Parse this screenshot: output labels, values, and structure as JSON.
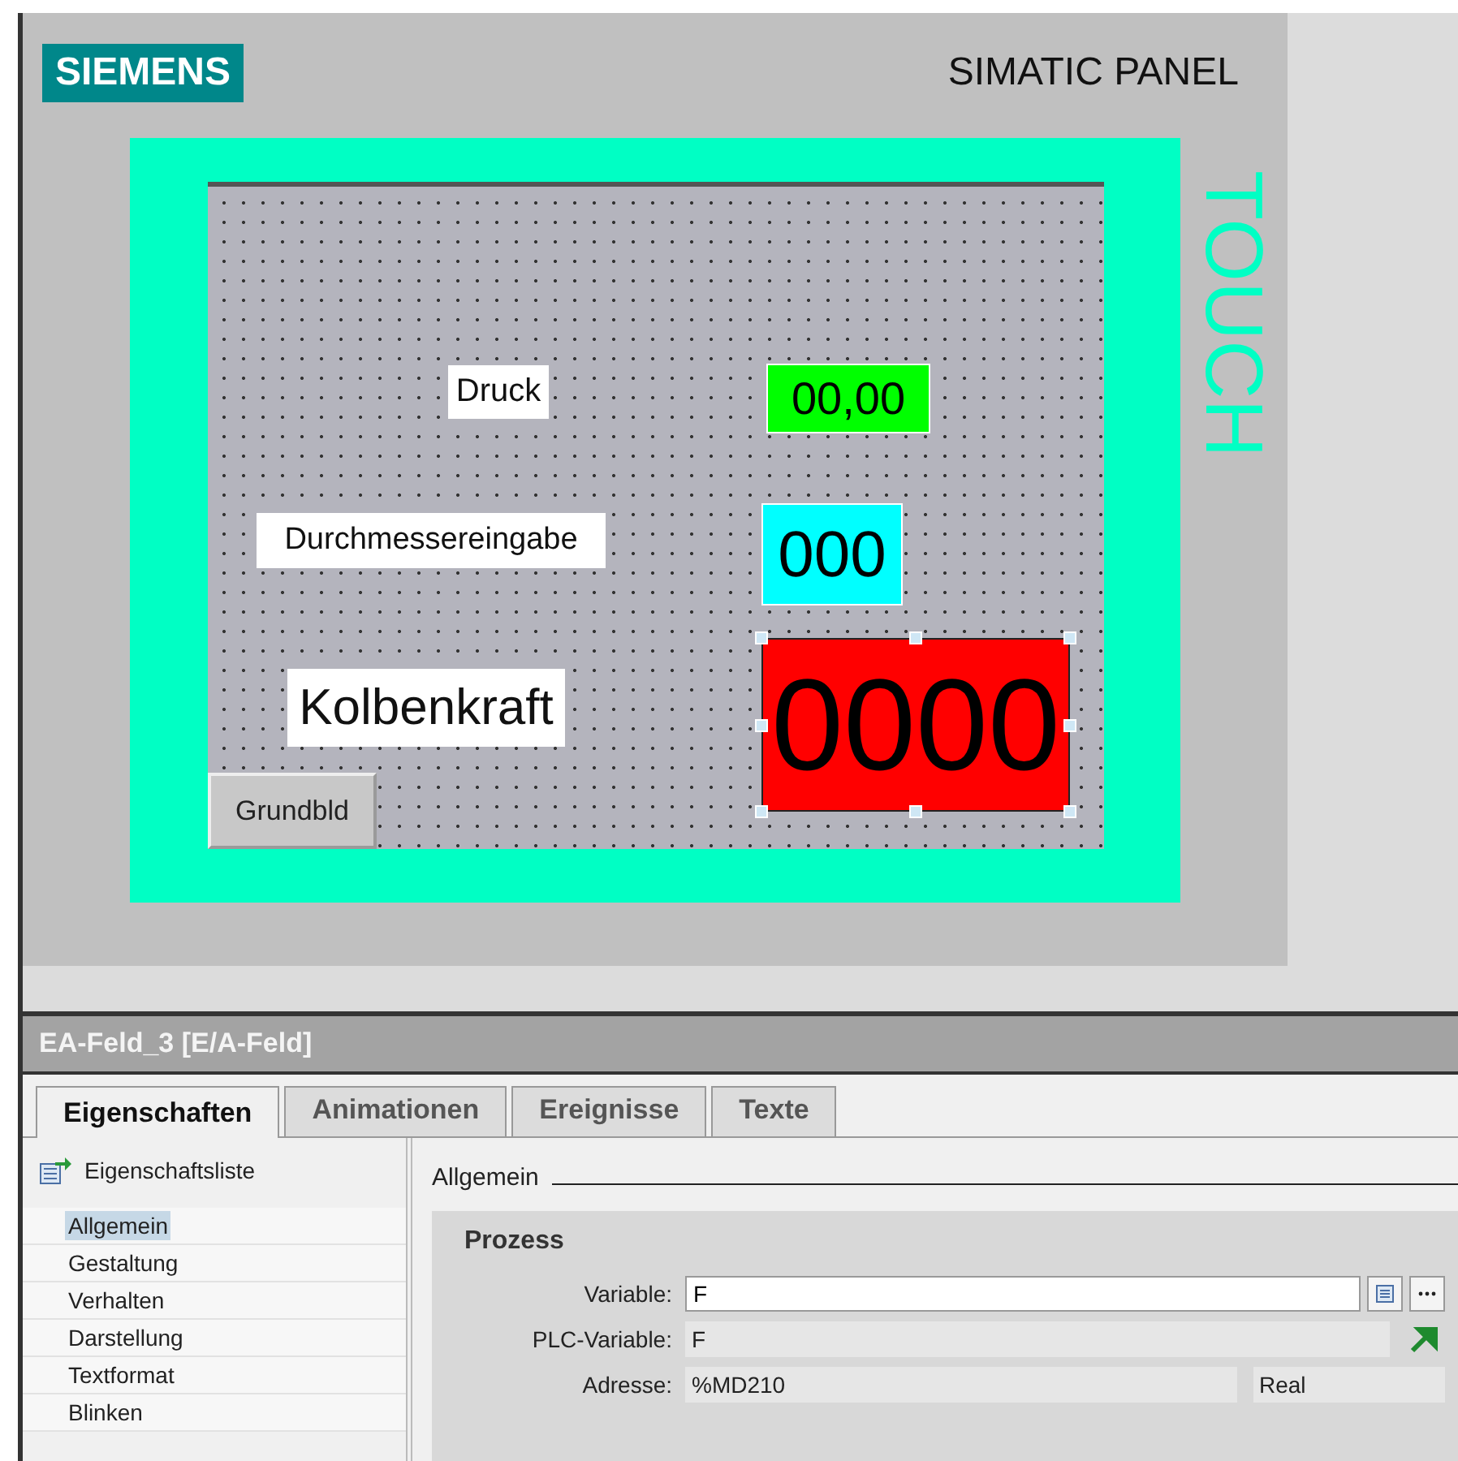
{
  "panel": {
    "logo": "SIEMENS",
    "model": "SIMATIC PANEL",
    "touch": "TOUCH"
  },
  "screen": {
    "objects": [
      {
        "kind": "label",
        "text": "Druck"
      },
      {
        "kind": "io_field",
        "text": "00,00",
        "color": "#00ff00",
        "selected": false
      },
      {
        "kind": "label",
        "text": "Durchmessereingabe"
      },
      {
        "kind": "io_field",
        "text": "000",
        "color": "#00ffff",
        "selected": false
      },
      {
        "kind": "label",
        "text": "Kolbenkraft"
      },
      {
        "kind": "io_field",
        "text": "0000",
        "color": "#ff0000",
        "selected": true
      },
      {
        "kind": "button",
        "text": "Grundbld"
      }
    ]
  },
  "inspector": {
    "title": "EA-Feld_3 [E/A-Feld]",
    "tabs": [
      {
        "label": "Eigenschaften",
        "selected": true
      },
      {
        "label": "Animationen",
        "selected": false
      },
      {
        "label": "Ereignisse",
        "selected": false
      },
      {
        "label": "Texte",
        "selected": false
      }
    ],
    "sidebar": {
      "header": "Eigenschaftsliste",
      "items": [
        {
          "label": "Allgemein",
          "selected": true
        },
        {
          "label": "Gestaltung",
          "selected": false
        },
        {
          "label": "Verhalten",
          "selected": false
        },
        {
          "label": "Darstellung",
          "selected": false
        },
        {
          "label": "Textformat",
          "selected": false
        },
        {
          "label": "Blinken",
          "selected": false
        }
      ]
    },
    "section": "Allgemein",
    "group": {
      "title": "Prozess",
      "fields": [
        {
          "kind": "input",
          "label": "Variable:",
          "value": "F"
        },
        {
          "kind": "link",
          "label": "PLC-Variable:",
          "value": "F"
        },
        {
          "kind": "address",
          "label": "Adresse:",
          "value": "%MD210",
          "type": "Real"
        }
      ]
    }
  }
}
